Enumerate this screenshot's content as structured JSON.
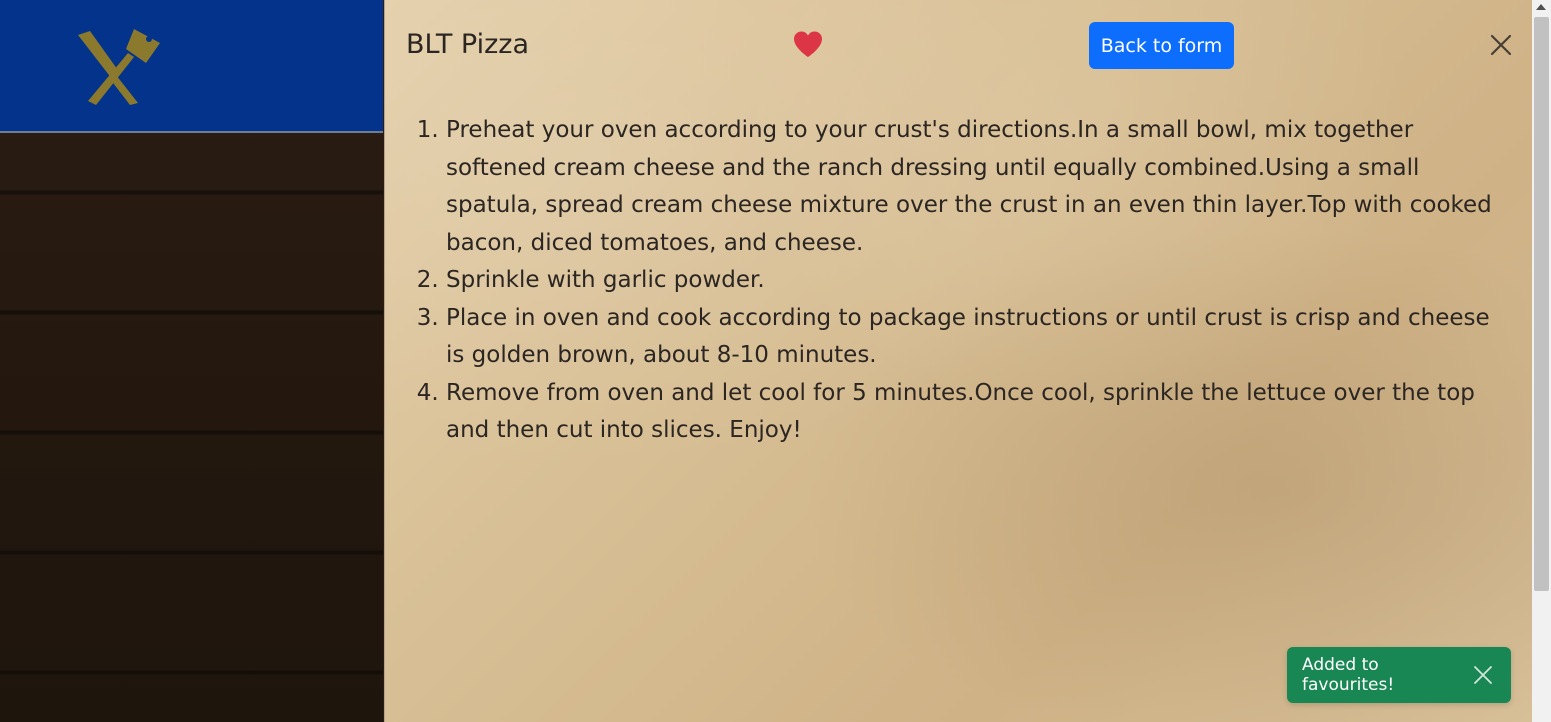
{
  "left": {
    "logo_icon": "crossed-cleaver-knife-icon",
    "brand_color": "#03338a",
    "logo_color": "#8b7a2e"
  },
  "offcanvas": {
    "title": "BLT Pizza",
    "favourite_icon": "heart-icon",
    "favourite_color": "#dc3545",
    "back_button_label": "Back to form",
    "close_icon": "close-icon",
    "steps": [
      "Preheat your oven according to your crust's directions.In a small bowl, mix together softened cream cheese and the ranch dressing until equally combined.Using a small spatula, spread cream cheese mixture over the crust in an even thin layer.Top with cooked bacon, diced tomatoes, and cheese.",
      "Sprinkle with garlic powder.",
      "Place in oven and cook according to package instructions or until crust is crisp and cheese is golden brown, about 8-10 minutes.",
      "Remove from oven and let cool for 5 minutes.Once cool, sprinkle the lettuce over the top and then cut into slices. Enjoy!"
    ]
  },
  "toast": {
    "message": "Added to favourites!",
    "color": "#198754",
    "close_icon": "close-icon"
  },
  "colors": {
    "primary": "#0d6efd",
    "text": "#2b2622"
  }
}
